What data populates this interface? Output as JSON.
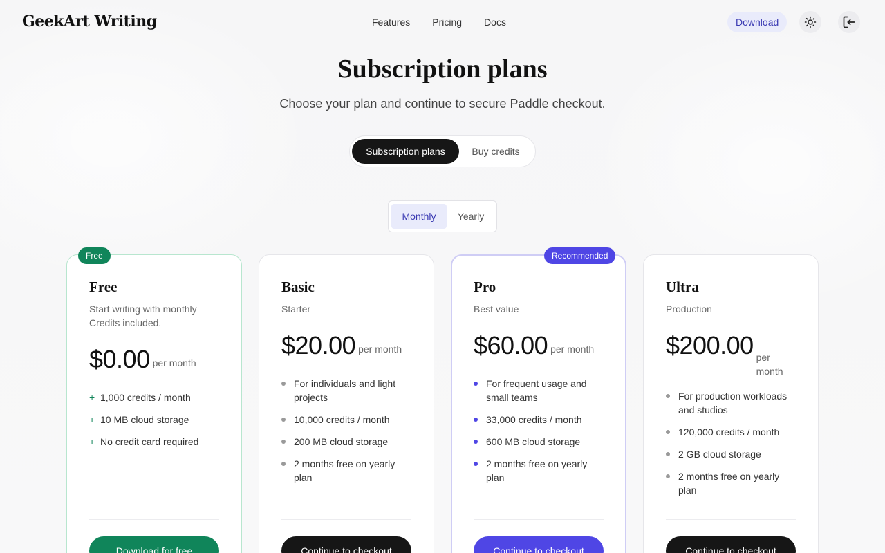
{
  "brand": "GeekArt Writing",
  "nav": [
    "Features",
    "Pricing",
    "Docs"
  ],
  "header": {
    "download_label": "Download",
    "theme_icon": "sun-icon",
    "login_icon": "sign-in-icon"
  },
  "hero": {
    "title": "Subscription plans",
    "subtitle": "Choose your plan and continue to secure Paddle checkout."
  },
  "main_toggle": {
    "active": "Subscription plans",
    "inactive": "Buy credits"
  },
  "period_toggle": {
    "active": "Monthly",
    "inactive": "Yearly"
  },
  "plans": [
    {
      "badge": "Free",
      "name": "Free",
      "desc": "Start writing with monthly Credits included.",
      "price": "$0.00",
      "per": "per month",
      "features": [
        "1,000 credits / month",
        "10 MB cloud storage",
        "No credit card required"
      ],
      "cta": "Download for free"
    },
    {
      "name": "Basic",
      "desc": "Starter",
      "price": "$20.00",
      "per": "per month",
      "features": [
        "For individuals and light projects",
        "10,000 credits / month",
        "200 MB cloud storage",
        "2 months free on yearly plan"
      ],
      "cta": "Continue to checkout"
    },
    {
      "badge": "Recommended",
      "name": "Pro",
      "desc": "Best value",
      "price": "$60.00",
      "per": "per month",
      "features": [
        "For frequent usage and small teams",
        "33,000 credits / month",
        "600 MB cloud storage",
        "2 months free on yearly plan"
      ],
      "cta": "Continue to checkout"
    },
    {
      "name": "Ultra",
      "desc": "Production",
      "price": "$200.00",
      "per": "per month",
      "features": [
        "For production workloads and studios",
        "120,000 credits / month",
        "2 GB cloud storage",
        "2 months free on yearly plan"
      ],
      "cta": "Continue to checkout"
    }
  ],
  "colors": {
    "accent": "#4f46e5",
    "free_green": "#10855a",
    "dark": "#161616",
    "accent_soft": "#e9ebfb"
  }
}
